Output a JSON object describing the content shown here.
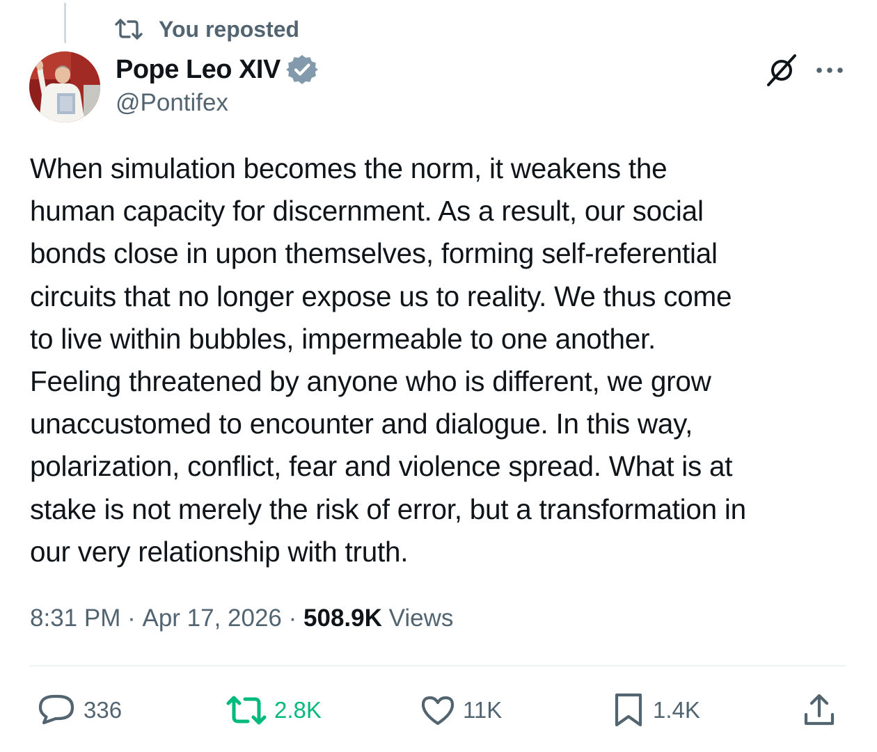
{
  "repost_banner": {
    "icon": "repost-icon",
    "label": "You reposted"
  },
  "author": {
    "display_name": "Pope Leo XIV",
    "handle": "@Pontifex",
    "verified": true,
    "verified_color": "#829aab",
    "avatar": "avatar-photo"
  },
  "header_actions": {
    "grok_icon": "grok-icon",
    "more_icon": "more-icon"
  },
  "post": {
    "text": "When simulation becomes the norm, it weakens the\nhuman capacity for discernment.  As a result, our social\nbonds close in upon themselves, forming self-referential\ncircuits that no longer expose us to reality.  We thus come\nto live within bubbles, impermeable to one another.\nFeeling threatened by anyone who is different, we grow\nunaccustomed to encounter and dialogue.  In this way,\npolarization, conflict, fear and violence spread.  What is at\nstake is not merely the risk of error, but a transformation in\nour very relationship with truth."
  },
  "meta": {
    "time": "8:31 PM",
    "separator": " · ",
    "date": "Apr 17, 2026",
    "views_count": "508.9K",
    "views_label": "Views"
  },
  "actions": {
    "replies": "336",
    "reposts": "2.8K",
    "likes": "11K",
    "bookmarks": "1.4K"
  },
  "colors": {
    "text_primary": "#0f1419",
    "text_secondary": "#536471",
    "repost_active": "#00ba7c",
    "divider": "#eff3f4"
  }
}
